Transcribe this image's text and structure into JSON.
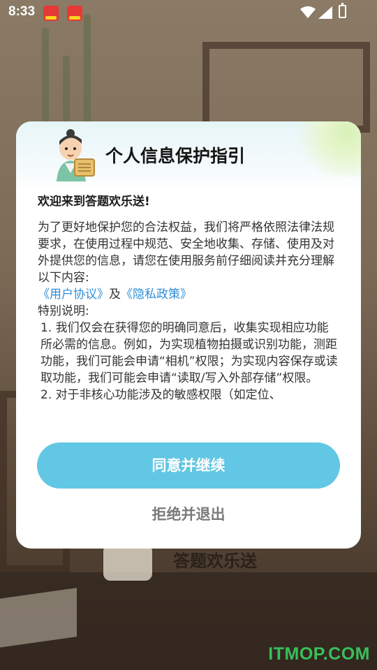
{
  "status_bar": {
    "time": "8:33",
    "notifications": [
      "app-icon-1",
      "app-icon-2"
    ],
    "icons": [
      "wifi-icon",
      "signal-icon",
      "battery-charging-icon"
    ]
  },
  "background": {
    "app_title": "答题欢乐送"
  },
  "dialog": {
    "title": "个人信息保护指引",
    "welcome": "欢迎来到答题欢乐送!",
    "intro": "为了更好地保护您的合法权益，我们将严格依照法律法规要求，在使用过程中规范、安全地收集、存储、使用及对外提供您的信息，请您在使用服务前仔细阅读并充分理解以下内容:",
    "user_agreement_link": "《用户协议》",
    "and_text": "及",
    "privacy_policy_link": "《隐私政策》",
    "special_note_label": "特别说明:",
    "point1": "1. 我们仅会在获得您的明确同意后，收集实现相应功能所必需的信息。例如，为实现植物拍摄或识别功能，测距功能，我们可能会申请“相机”权限；为实现内容保存或读取功能，我们可能会申请“读取/写入外部存储”权限。",
    "point2": "2. 对于非核心功能涉及的敏感权限（如定位、",
    "agree_button": "同意并继续",
    "reject_button": "拒绝并退出"
  },
  "watermark": "ITMOP.COM",
  "colors": {
    "primary_button": "#62c7e4",
    "link": "#2f8fd8",
    "watermark": "#38c05a"
  }
}
